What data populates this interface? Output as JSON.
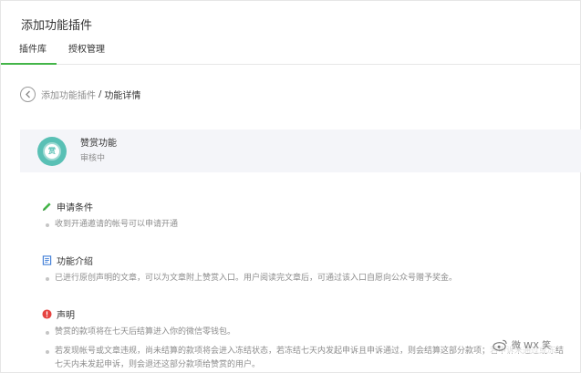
{
  "page": {
    "title": "添加功能插件"
  },
  "tabs": [
    {
      "label": "插件库",
      "active": true
    },
    {
      "label": "授权管理",
      "active": false
    }
  ],
  "breadcrumb": {
    "parent": "添加功能插件",
    "separator": "/",
    "current": "功能详情",
    "back_icon": "chevron-left-icon"
  },
  "plugin": {
    "name": "赞赏功能",
    "status": "审核中",
    "logo_glyph": "赏",
    "logo_color": "#59c0b5"
  },
  "sections": {
    "conditions": {
      "title": "申请条件",
      "icon": "pencil-icon",
      "items": [
        "收到开通邀请的帐号可以申请开通"
      ]
    },
    "intro": {
      "title": "功能介绍",
      "icon": "document-icon",
      "items": [
        "已进行原创声明的文章，可以为文章附上赞赏入口。用户阅读完文章后，可通过该入口自愿向公众号赠予奖金。"
      ]
    },
    "statement": {
      "title": "声明",
      "icon": "alert-icon",
      "items": [
        "赞赏的款项将在七天后结算进入你的微信零钱包。",
        "若发现帐号或文章违规，尚未结算的款项将会进入冻结状态，若冻结七天内发起申诉且申诉通过，则会结算这部分款项；若申诉未通过或冻结七天内未发起申诉，则会退还这部分款项给赞赏的用户。"
      ]
    }
  },
  "watermark": {
    "text": "微 WX 笑",
    "icon": "weibo-icon"
  },
  "colors": {
    "accent": "#44b549",
    "alert": "#e64340",
    "muted": "#8d8d8d",
    "card_bg": "#f4f5f9"
  }
}
